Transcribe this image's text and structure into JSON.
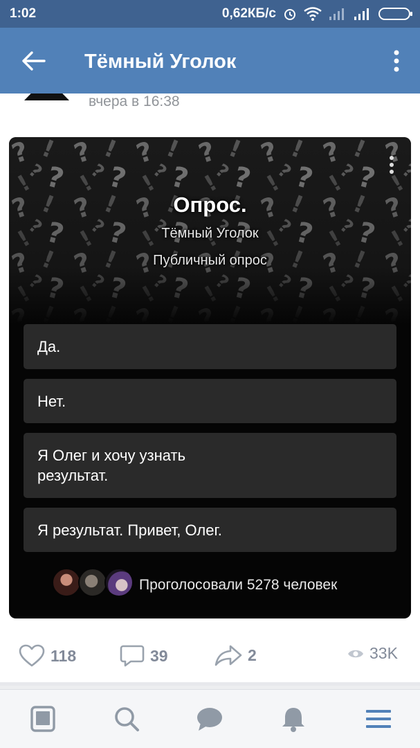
{
  "status_bar": {
    "time": "1:02",
    "net_speed": "0,62КБ/с"
  },
  "app_bar": {
    "title": "Тёмный Уголок"
  },
  "post": {
    "timestamp": "вчера в 16:38"
  },
  "poll": {
    "title": "Опрос.",
    "author": "Тёмный Уголок",
    "type": "Публичный опрос",
    "options": [
      {
        "label": "Да."
      },
      {
        "label": "Нет."
      },
      {
        "label": "Я Олег и хочу узнать\nрезультат."
      },
      {
        "label": "Я результат. Привет, Олег."
      }
    ],
    "voted_text": "Проголосовали 5278 человек"
  },
  "actions": {
    "likes": "118",
    "comments": "39",
    "shares": "2",
    "views": "33K"
  },
  "bottom_nav": [
    "news-icon",
    "search-icon",
    "messages-icon",
    "notifications-icon",
    "menu-icon"
  ],
  "colors": {
    "header": "#5181b8",
    "status_bar": "#3f6290",
    "accent": "#5181b8",
    "poll_bg": "#050505"
  }
}
